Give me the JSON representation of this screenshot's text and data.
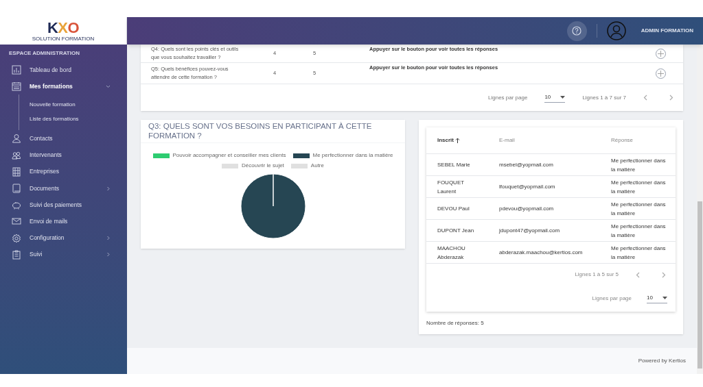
{
  "logo": {
    "mark": "KXO",
    "tagline": "SOLUTION FORMATION"
  },
  "sidebar": {
    "section_title": "ESPACE ADMINISTRATION",
    "items": [
      {
        "label": "Tableau de bord",
        "selected": false
      },
      {
        "label": "Mes formations",
        "selected": true,
        "expanded": true,
        "children": [
          {
            "label": "Nouvelle formation",
            "selected": false
          },
          {
            "label": "Liste des formations",
            "selected": false
          }
        ]
      },
      {
        "label": "Contacts",
        "selected": false
      },
      {
        "label": "Intervenants",
        "selected": false
      },
      {
        "label": "Entreprises",
        "selected": false
      },
      {
        "label": "Documents",
        "selected": false,
        "expanded": false
      },
      {
        "label": "Suivi des paiements",
        "selected": false
      },
      {
        "label": "Envoi de mails",
        "selected": false
      },
      {
        "label": "Configuration",
        "selected": false,
        "expanded": false
      },
      {
        "label": "Suivi",
        "selected": false,
        "expanded": false
      }
    ]
  },
  "header": {
    "user_name": "ADMIN FORMATION"
  },
  "questions_table": {
    "rows": [
      {
        "question": "Q4: Quels sont les points clés et outils que vous souhaitez travailler ?",
        "column_2": "4",
        "column_3": "5",
        "answers": "Appuyer sur le bouton pour voir toutes les réponses"
      },
      {
        "question": "Q5: Quels bénéfices pouvez-vous attendre de cette formation ?",
        "column_2": "4",
        "column_3": "5",
        "answers": "Appuyer sur le bouton pour voir toutes les réponses"
      }
    ],
    "rows_per_page_label": "Lignes par page",
    "rows_per_page": "10",
    "range": "Lignes 1 à 7 sur 7"
  },
  "chart_card": {
    "title": "Q3: QUELS SONT VOS BESOINS EN PARTICIPANT À CETTE FORMATION ?",
    "chart_data": {
      "type": "pie",
      "categories": [
        "Pouvoir accompagner et conseiller mes clients",
        "Me perfectionner dans la matière",
        "Découvrir le sujet",
        "Autre"
      ],
      "values": [
        0,
        100,
        0,
        0
      ],
      "colors": [
        "#2ecc71",
        "#264653",
        "#e0e0e0",
        "#e0e0e0"
      ]
    }
  },
  "responses_table": {
    "columns": [
      {
        "label": "Inscrit",
        "sorted": true
      },
      {
        "label": "E-mail",
        "sorted": false
      },
      {
        "label": "Réponse",
        "sorted": false
      }
    ],
    "rows": [
      {
        "name": "SEBEL Marie",
        "email": "msebel@yopmail.com",
        "answer": "Me perfectionner dans la matière"
      },
      {
        "name": "FOUQUET Laurent",
        "email": "lfouquet@yopmail.com",
        "answer": "Me perfectionner dans la matière"
      },
      {
        "name": "DEVOU Paul",
        "email": "pdevou@yopmail.com",
        "answer": "Me perfectionner dans la matière"
      },
      {
        "name": "DUPONT Jean",
        "email": "jdupont47@yopmail.com",
        "answer": "Me perfectionner dans la matière"
      },
      {
        "name": "MAACHOU Abderazak",
        "email": "abderazak.maachou@kertios.com",
        "answer": "Me perfectionner dans la matière"
      }
    ],
    "range": "Lignes 1 à 5 sur 5",
    "rows_per_page_label": "Lignes par page",
    "rows_per_page": "10",
    "count": "Nombre de réponses: 5"
  },
  "footer": {
    "text": "Powered by Kertios"
  }
}
